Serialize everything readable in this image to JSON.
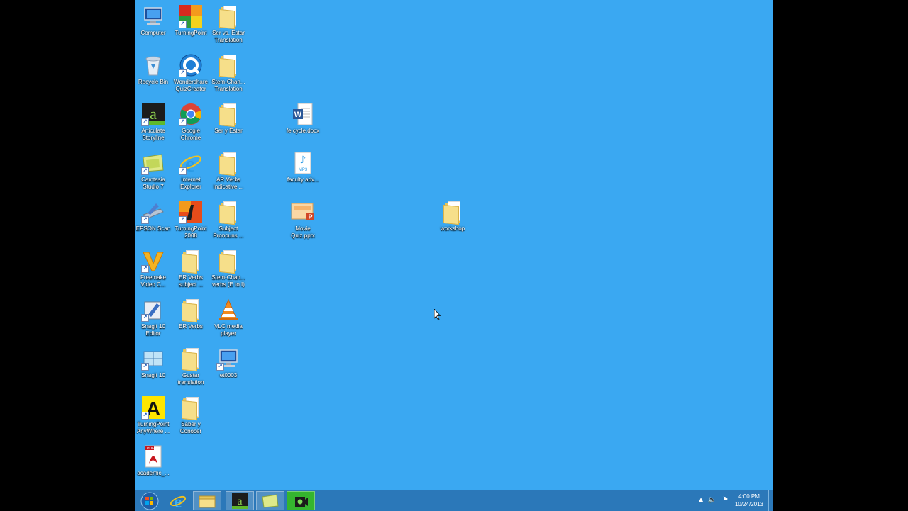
{
  "desktop": {
    "icons": [
      {
        "label": "Computer",
        "icon": "computer-icon"
      },
      {
        "label": "TurningPoint",
        "icon": "turningpoint-icon"
      },
      {
        "label": "Ser vs. Estar Translation",
        "icon": "folder-icon"
      },
      {
        "label": "Recycle Bin",
        "icon": "recycle-bin-icon"
      },
      {
        "label": "Wondershare QuizCreator",
        "icon": "quizcreator-icon"
      },
      {
        "label": "Stem-Chan... Translation",
        "icon": "folder-icon"
      },
      {
        "label": "Articulate Storyline",
        "icon": "articulate-icon"
      },
      {
        "label": "Google Chrome",
        "icon": "chrome-icon"
      },
      {
        "label": "Ser y Estar",
        "icon": "folder-icon"
      },
      {
        "label": "fe cycle.docx",
        "icon": "word-doc-icon"
      },
      {
        "label": "Camtasia Studio 7",
        "icon": "camtasia-icon"
      },
      {
        "label": "Internet Explorer",
        "icon": "ie-icon"
      },
      {
        "label": "AR Verbs Indicative ...",
        "icon": "folder-icon"
      },
      {
        "label": "faculty adv...",
        "icon": "mp3-icon"
      },
      {
        "label": "EPSON Scan",
        "icon": "scanner-icon"
      },
      {
        "label": "TurningPoint 2008",
        "icon": "turningpoint2008-icon"
      },
      {
        "label": "Subject Pronouns ...",
        "icon": "folder-icon"
      },
      {
        "label": "Movie Quiz.pptx",
        "icon": "powerpoint-icon"
      },
      {
        "label": "workshop",
        "icon": "folder-icon"
      },
      {
        "label": "Freemake Video C...",
        "icon": "freemake-icon"
      },
      {
        "label": "ER Verbs subject ...",
        "icon": "folder-icon"
      },
      {
        "label": "Stem-Chan... verbs (E to I)",
        "icon": "folder-icon"
      },
      {
        "label": "Snagit 10 Editor",
        "icon": "snagit-editor-icon"
      },
      {
        "label": "ER Verbs",
        "icon": "folder-icon"
      },
      {
        "label": "VLC media player",
        "icon": "vlc-icon"
      },
      {
        "label": "Snagit 10",
        "icon": "snagit-icon"
      },
      {
        "label": "Gustar translation",
        "icon": "folder-icon"
      },
      {
        "label": "et0003",
        "icon": "computer-icon"
      },
      {
        "label": "TurningPoint AnyWhere ...",
        "icon": "turningpoint-anywhere-icon"
      },
      {
        "label": "Saber y Conocer",
        "icon": "folder-icon"
      },
      {
        "label": "academic_...",
        "icon": "pdf-icon"
      }
    ]
  },
  "taskbar": {
    "buttons": [
      {
        "name": "start-button",
        "icon": "windows-orb-icon"
      },
      {
        "name": "internet-explorer-taskbar-button",
        "icon": "ie-icon"
      },
      {
        "name": "file-explorer-taskbar-button",
        "icon": "folder-icon"
      },
      {
        "name": "articulate-taskbar-button",
        "icon": "articulate-icon"
      },
      {
        "name": "camtasia-taskbar-button",
        "icon": "camtasia-icon"
      },
      {
        "name": "camtasia-recorder-taskbar-button",
        "icon": "camera-icon"
      }
    ],
    "clock": {
      "time": "4:00 PM",
      "date": "10/24/2013"
    }
  },
  "colors": {
    "desktop": "#3aa8f2",
    "taskbar": "#2b78b9",
    "letterbox": "#000000"
  }
}
